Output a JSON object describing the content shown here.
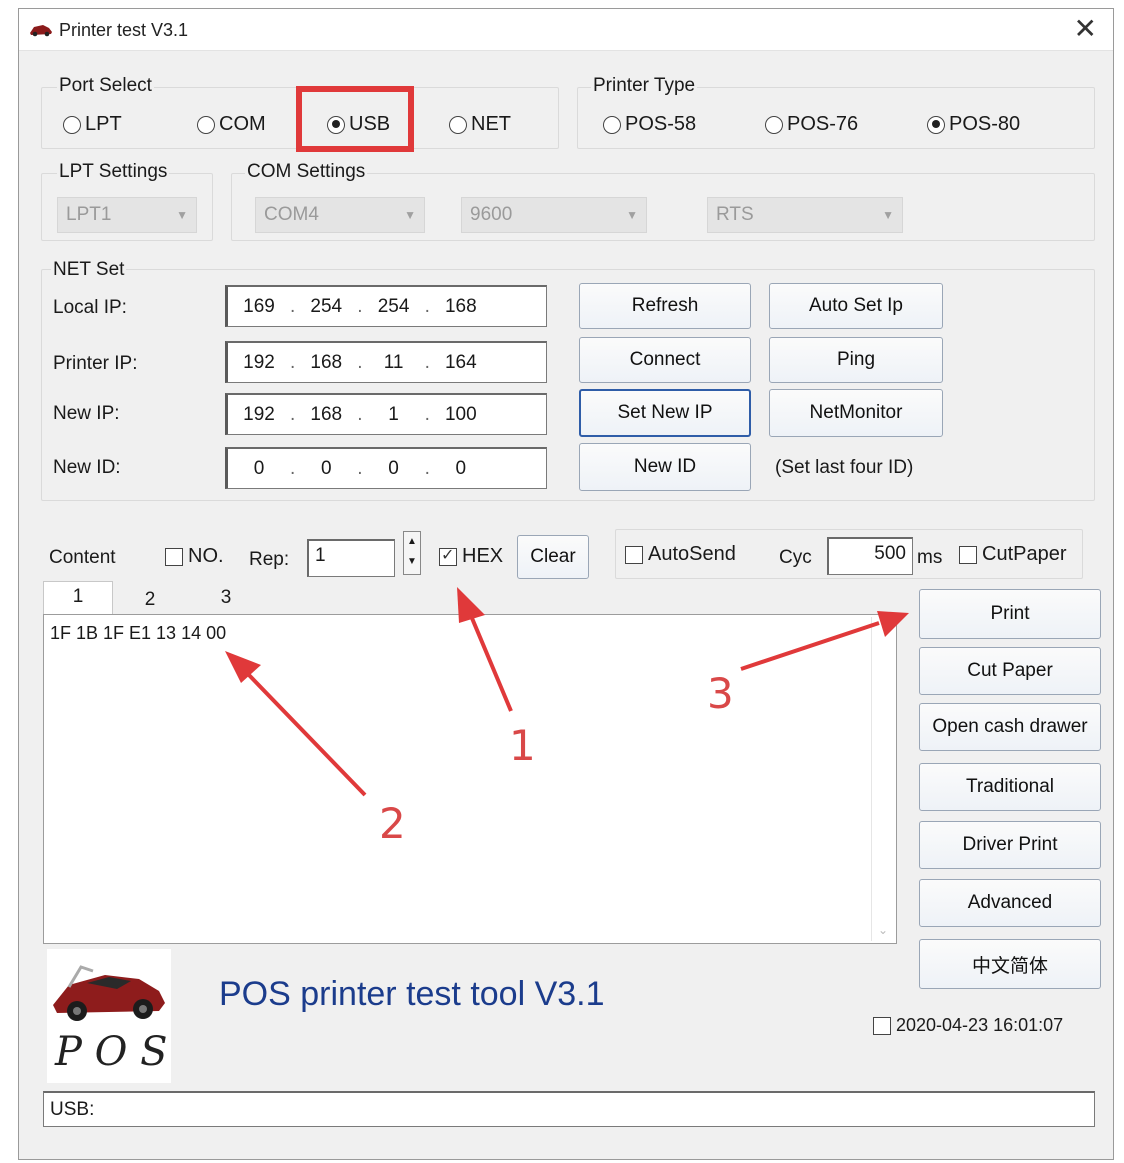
{
  "window": {
    "title": "Printer test V3.1",
    "close_glyph": "✕"
  },
  "port_select": {
    "label": "Port Select",
    "options": [
      "LPT",
      "COM",
      "USB",
      "NET"
    ],
    "selected": "USB"
  },
  "printer_type": {
    "label": "Printer Type",
    "options": [
      "POS-58",
      "POS-76",
      "POS-80"
    ],
    "selected": "POS-80"
  },
  "lpt_settings": {
    "label": "LPT Settings",
    "port": "LPT1"
  },
  "com_settings": {
    "label": "COM Settings",
    "port": "COM4",
    "baud": "9600",
    "flow": "RTS"
  },
  "net_set": {
    "label": "NET Set",
    "rows": [
      {
        "label": "Local IP:",
        "octets": [
          "169",
          "254",
          "254",
          "168"
        ]
      },
      {
        "label": "Printer IP:",
        "octets": [
          "192",
          "168",
          "11",
          "164"
        ]
      },
      {
        "label": "New IP:",
        "octets": [
          "192",
          "168",
          "1",
          "100"
        ]
      },
      {
        "label": "New ID:",
        "octets": [
          "0",
          "0",
          "0",
          "0"
        ]
      }
    ],
    "buttons": {
      "refresh": "Refresh",
      "auto_set_ip": "Auto Set Ip",
      "connect": "Connect",
      "ping": "Ping",
      "set_new_ip": "Set New IP",
      "net_monitor": "NetMonitor",
      "new_id": "New ID"
    },
    "hint": "(Set last four ID)"
  },
  "content_bar": {
    "content_label": "Content",
    "no_label": "NO.",
    "rep_label": "Rep:",
    "rep_value": "1",
    "hex_label": "HEX",
    "hex_checked": true,
    "clear_label": "Clear",
    "autosend_label": "AutoSend",
    "cyc_label": "Cyc",
    "cyc_value": "500",
    "ms_label": "ms",
    "cutpaper_label": "CutPaper"
  },
  "tabs": [
    "1",
    "2",
    "3"
  ],
  "editor_text": "1F 1B 1F E1 13 14 00",
  "side_buttons": {
    "print": "Print",
    "cut_paper": "Cut Paper",
    "open_cash_drawer": "Open cash drawer",
    "traditional": "Traditional",
    "driver_print": "Driver Print",
    "advanced": "Advanced",
    "chinese": "中文简体"
  },
  "footer": {
    "app_name": "POS printer test tool V3.1",
    "logo_text": "P O S",
    "datetime": "2020-04-23 16:01:07",
    "status": "USB:"
  },
  "annotations": [
    "1",
    "2",
    "3"
  ],
  "colors": {
    "annotation_red": "#e0393a",
    "selected_button_border": "#2f5da8",
    "app_name_blue": "#1b3c8c"
  }
}
